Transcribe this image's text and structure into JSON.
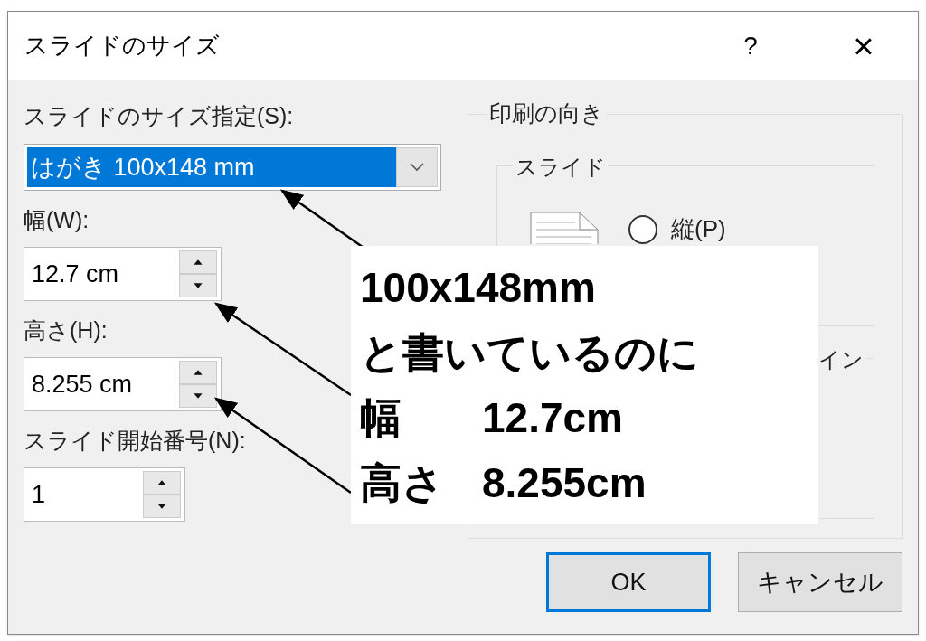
{
  "window": {
    "title": "スライドのサイズ",
    "help": "?",
    "close": "×"
  },
  "slide_size": {
    "label": "スライドのサイズ指定(S):",
    "value": "はがき 100x148 mm",
    "selected": true
  },
  "fields": [
    {
      "label": "幅(W):",
      "value": "12.7 cm"
    },
    {
      "label": "高さ(H):",
      "value": "8.255 cm"
    },
    {
      "label": "スライド開始番号(N):",
      "value": "1"
    }
  ],
  "orientation": {
    "title": "印刷の向き",
    "groups": [
      {
        "title": "スライド",
        "options": [
          {
            "label": "縦(P)",
            "selected": false
          }
        ]
      },
      {
        "title": "イン"
      }
    ]
  },
  "buttons": [
    {
      "label": "OK",
      "default": true
    },
    {
      "label": "キャンセル",
      "default": false
    }
  ],
  "callout": {
    "lines": [
      "100x148mm",
      "と書いているのに"
    ],
    "values": [
      {
        "label": "幅",
        "value": "12.7cm"
      },
      {
        "label": "高さ",
        "value": "8.255cm"
      }
    ]
  }
}
